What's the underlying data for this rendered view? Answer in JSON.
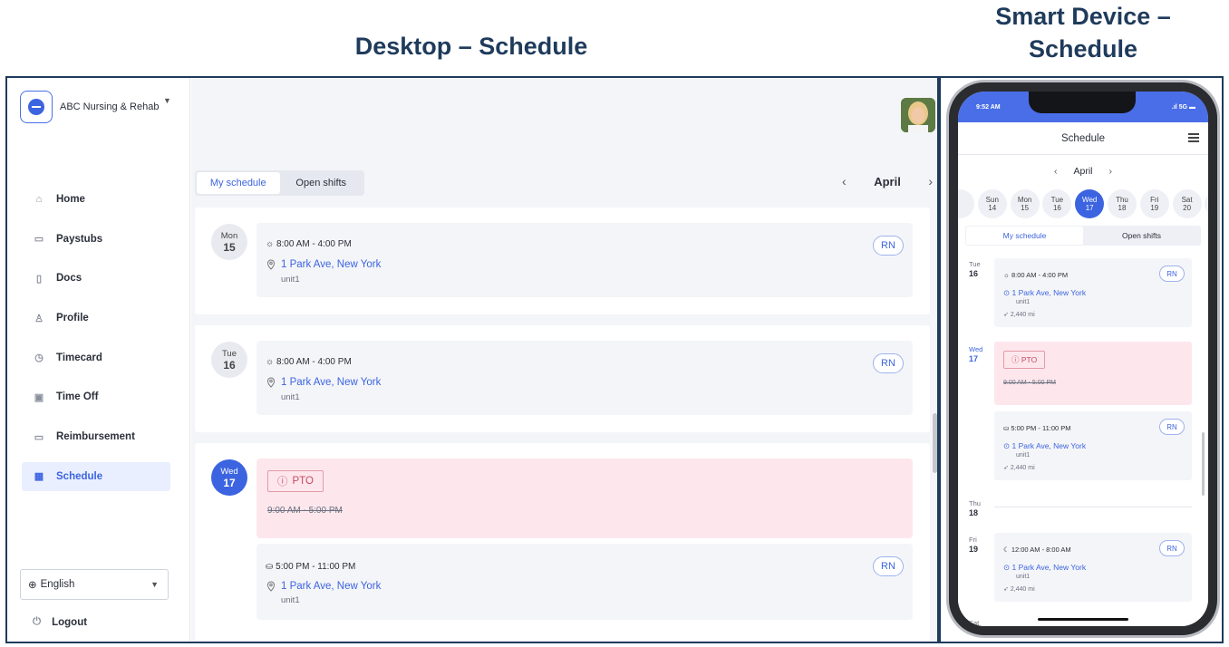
{
  "headings": {
    "desktop": "Desktop – Schedule",
    "mobile": "Smart Device – Schedule"
  },
  "desktop": {
    "org_name": "ABC Nursing & Rehab",
    "nav": [
      {
        "label": "Home",
        "icon": "home-icon"
      },
      {
        "label": "Paystubs",
        "icon": "money-icon"
      },
      {
        "label": "Docs",
        "icon": "document-icon"
      },
      {
        "label": "Profile",
        "icon": "user-icon"
      },
      {
        "label": "Timecard",
        "icon": "clock-icon"
      },
      {
        "label": "Time Off",
        "icon": "calendar-x-icon"
      },
      {
        "label": "Reimbursement",
        "icon": "card-icon"
      },
      {
        "label": "Schedule",
        "icon": "calendar-icon",
        "active": true
      }
    ],
    "language": "English",
    "logout": "Logout",
    "tabs": {
      "my_schedule": "My schedule",
      "open_shifts": "Open shifts"
    },
    "month": "April",
    "days": [
      {
        "dow": "Mon",
        "day": "15",
        "shifts": [
          {
            "time": "8:00 AM - 4:00 PM",
            "location": "1 Park Ave, New York",
            "unit": "unit1",
            "role": "RN"
          }
        ]
      },
      {
        "dow": "Tue",
        "day": "16",
        "shifts": [
          {
            "time": "8:00 AM - 4:00 PM",
            "location": "1 Park Ave, New York",
            "unit": "unit1",
            "role": "RN"
          }
        ]
      },
      {
        "dow": "Wed",
        "day": "17",
        "today": true,
        "pto": {
          "label": "PTO",
          "time": "9:00 AM - 5:00 PM"
        },
        "shifts": [
          {
            "time": "5:00 PM - 11:00 PM",
            "location": "1 Park Ave, New York",
            "unit": "unit1",
            "role": "RN"
          }
        ]
      }
    ]
  },
  "mobile": {
    "clock": "9:52 AM",
    "signal": "5G",
    "title": "Schedule",
    "month": "April",
    "week": [
      {
        "dow": "Sun",
        "day": "14"
      },
      {
        "dow": "Mon",
        "day": "15"
      },
      {
        "dow": "Tue",
        "day": "16"
      },
      {
        "dow": "Wed",
        "day": "17",
        "active": true
      },
      {
        "dow": "Thu",
        "day": "18"
      },
      {
        "dow": "Fri",
        "day": "19"
      },
      {
        "dow": "Sat",
        "day": "20"
      }
    ],
    "tabs": {
      "my_schedule": "My schedule",
      "open_shifts": "Open shifts"
    },
    "entries": {
      "tue": {
        "dow": "Tue",
        "day": "16",
        "time": "8:00 AM - 4:00 PM",
        "location": "1 Park Ave, New York",
        "unit": "unit1",
        "distance": "2,440 mi",
        "role": "RN"
      },
      "wed": {
        "dow": "Wed",
        "day": "17",
        "pto_label": "PTO",
        "pto_time": "9:00 AM - 5:00 PM",
        "time": "5:00 PM - 11:00 PM",
        "location": "1 Park Ave, New York",
        "unit": "unit1",
        "distance": "2,440 mi",
        "role": "RN"
      },
      "thu": {
        "dow": "Thu",
        "day": "18"
      },
      "fri": {
        "dow": "Fri",
        "day": "19",
        "time": "12:00 AM - 8:00 AM",
        "location": "1 Park Ave, New York",
        "unit": "unit1",
        "distance": "2,440 mi",
        "role": "RN"
      },
      "sat": {
        "dow": "Sat"
      }
    }
  }
}
